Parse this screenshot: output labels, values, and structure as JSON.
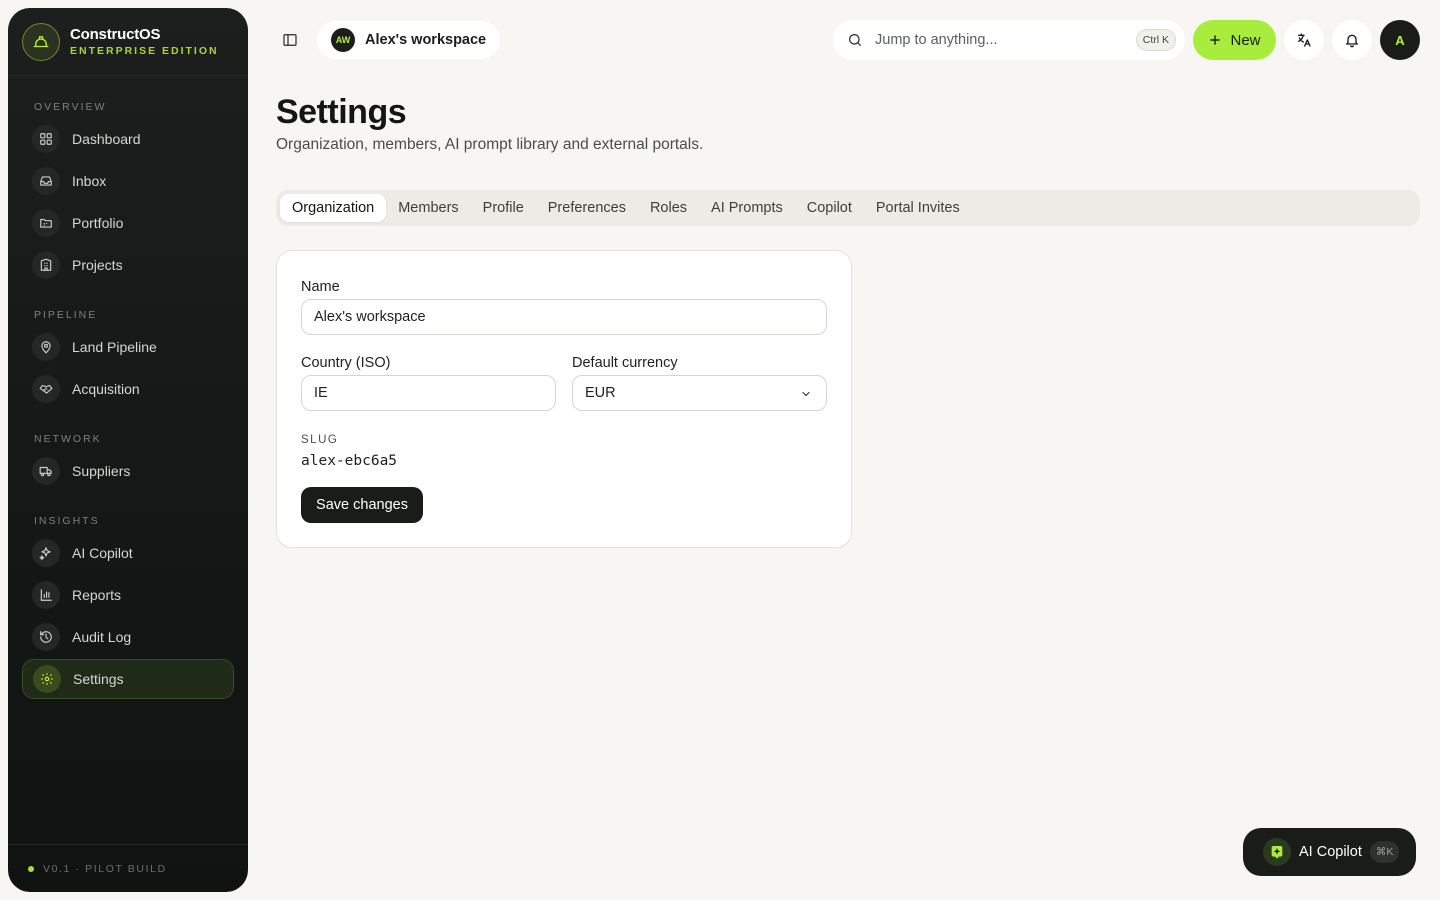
{
  "brand": {
    "name": "ConstructOS",
    "edition": "ENTERPRISE EDITION"
  },
  "sidebar": {
    "sections": [
      {
        "label": "OVERVIEW",
        "items": [
          {
            "label": "Dashboard",
            "icon": "dashboard-icon"
          },
          {
            "label": "Inbox",
            "icon": "inbox-icon"
          },
          {
            "label": "Portfolio",
            "icon": "portfolio-icon"
          },
          {
            "label": "Projects",
            "icon": "building-icon"
          }
        ]
      },
      {
        "label": "PIPELINE",
        "items": [
          {
            "label": "Land Pipeline",
            "icon": "map-pin-icon"
          },
          {
            "label": "Acquisition",
            "icon": "handshake-icon"
          }
        ]
      },
      {
        "label": "NETWORK",
        "items": [
          {
            "label": "Suppliers",
            "icon": "truck-icon"
          }
        ]
      },
      {
        "label": "INSIGHTS",
        "items": [
          {
            "label": "AI Copilot",
            "icon": "sparkles-icon"
          },
          {
            "label": "Reports",
            "icon": "bar-chart-icon"
          },
          {
            "label": "Audit Log",
            "icon": "history-icon"
          },
          {
            "label": "Settings",
            "icon": "gear-icon",
            "active": true
          }
        ]
      }
    ],
    "footer": "V0.1 · PILOT BUILD"
  },
  "header": {
    "workspace_initials": "AW",
    "workspace_name": "Alex's workspace",
    "search_placeholder": "Jump to anything...",
    "search_shortcut": "Ctrl K",
    "new_label": "New",
    "user_initial": "A"
  },
  "page": {
    "title": "Settings",
    "subtitle": "Organization, members, AI prompt library and external portals."
  },
  "tabs": [
    {
      "label": "Organization",
      "active": true
    },
    {
      "label": "Members"
    },
    {
      "label": "Profile"
    },
    {
      "label": "Preferences"
    },
    {
      "label": "Roles"
    },
    {
      "label": "AI Prompts"
    },
    {
      "label": "Copilot"
    },
    {
      "label": "Portal Invites"
    }
  ],
  "form": {
    "name_label": "Name",
    "name_value": "Alex's workspace",
    "country_label": "Country (ISO)",
    "country_value": "IE",
    "currency_label": "Default currency",
    "currency_value": "EUR",
    "slug_label": "SLUG",
    "slug_value": "alex-ebc6a5",
    "save_label": "Save changes"
  },
  "copilot": {
    "label": "AI Copilot",
    "shortcut": "⌘K"
  },
  "colors": {
    "accent": "#a8ed3e",
    "dark": "#1a1c1a",
    "background": "#f7f6f2"
  }
}
